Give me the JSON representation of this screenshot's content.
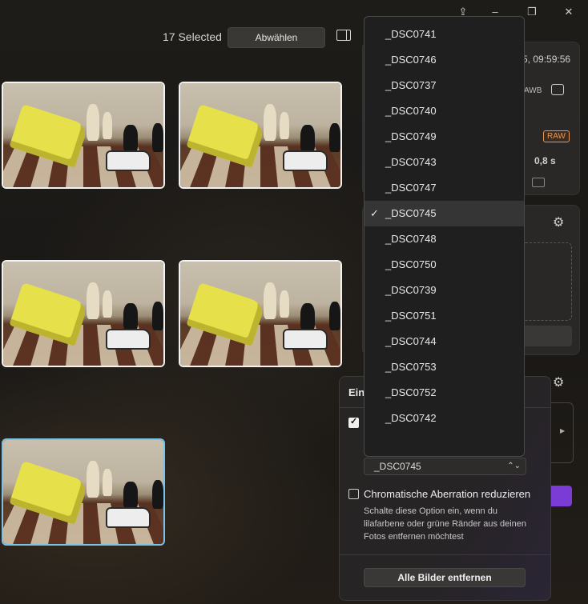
{
  "titlebar": {
    "share_icon": "share-icon",
    "minimize": "–",
    "restore": "❐",
    "close": "✕"
  },
  "toolbar": {
    "selected_count": "17 Selected",
    "deselect_label": "Abwählen",
    "panel_icon": "panel-toggle-icon"
  },
  "right_panel": {
    "timestamp": "5, 09:59:56",
    "awb": "AWB",
    "raw_badge": "RAW",
    "shutter": "0,8 s"
  },
  "flyout": {
    "title": "Ein",
    "select_value": "_DSC0745",
    "chromatic_label": "Chromatische Aberration reduzieren",
    "chromatic_desc": "Schalte diese Option ein, wenn du lilafarbene oder grüne Ränder aus deinen Fotos entfernen möchtest",
    "remove_all_label": "Alle Bilder entfernen"
  },
  "dropdown": {
    "items": [
      "_DSC0741",
      "_DSC0746",
      "_DSC0737",
      "_DSC0740",
      "_DSC0749",
      "_DSC0743",
      "_DSC0747",
      "_DSC0745",
      "_DSC0748",
      "_DSC0750",
      "_DSC0739",
      "_DSC0751",
      "_DSC0744",
      "_DSC0753",
      "_DSC0752",
      "_DSC0742"
    ],
    "selected": "_DSC0745"
  },
  "colors": {
    "accent_thumb": "#79c3ea",
    "purple": "#7b3cd6",
    "raw": "#e79a55"
  }
}
